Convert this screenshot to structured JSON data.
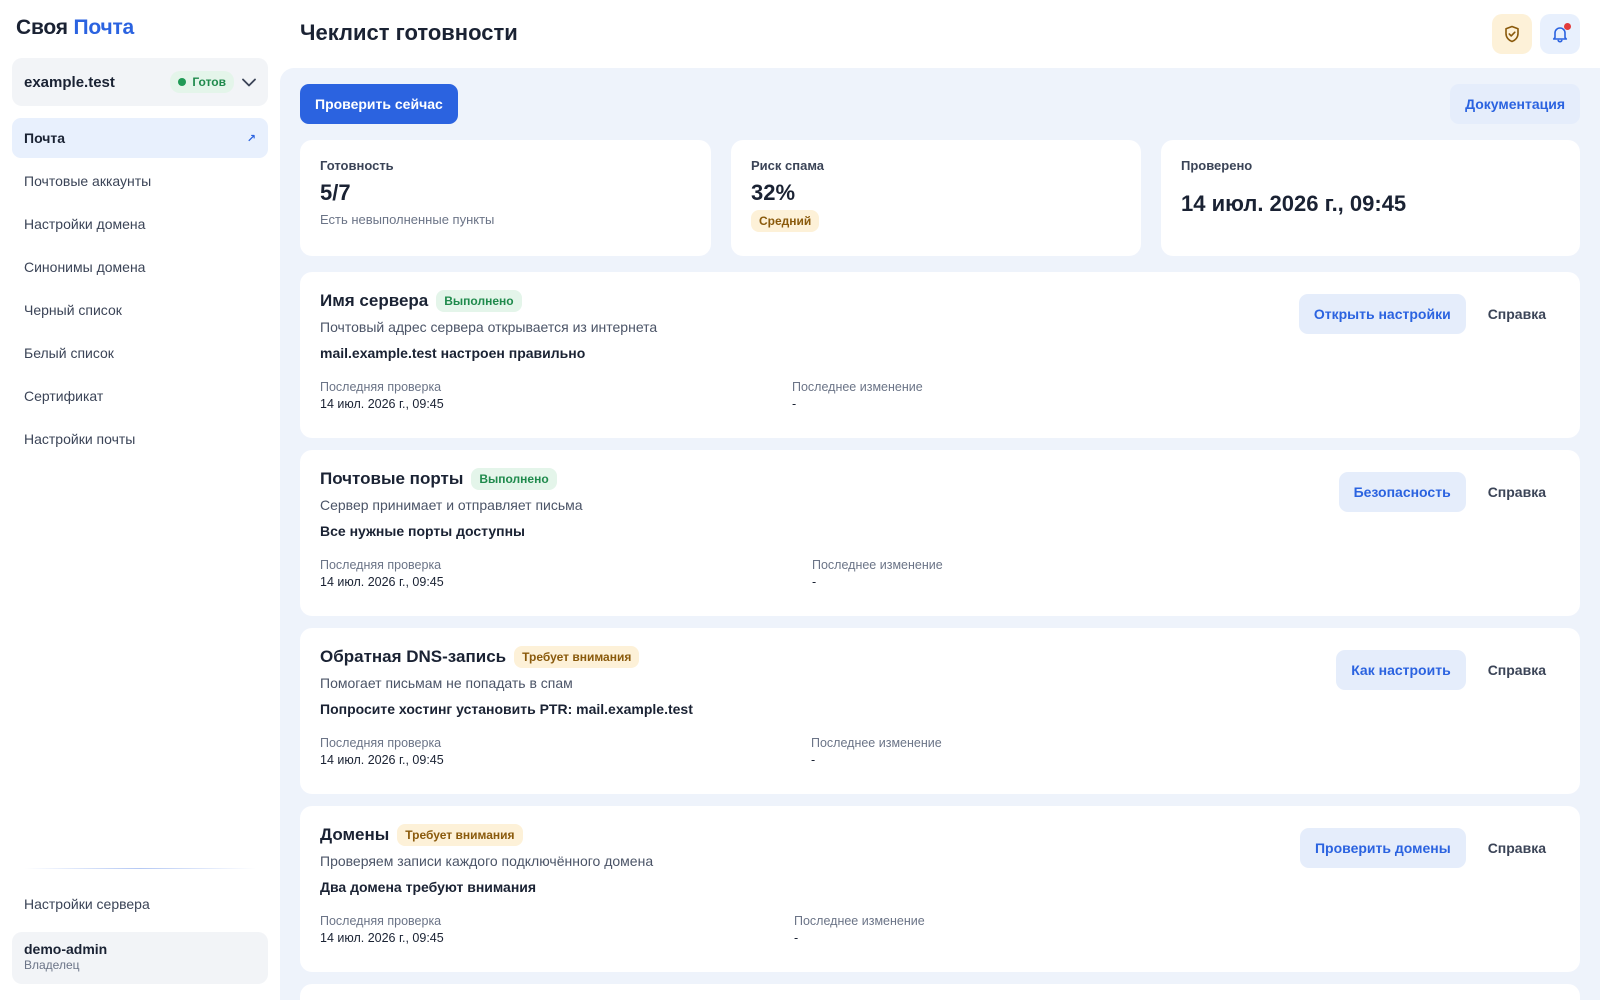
{
  "brand": {
    "part1": "Своя",
    "part2": "Почта"
  },
  "domain_selector": {
    "name": "example.test",
    "status": "Готов"
  },
  "nav": {
    "items": [
      {
        "label": "Почта",
        "active": true
      },
      {
        "label": "Почтовые аккаунты"
      },
      {
        "label": "Настройки домена"
      },
      {
        "label": "Синонимы домена"
      },
      {
        "label": "Черный список"
      },
      {
        "label": "Белый список"
      },
      {
        "label": "Сертификат"
      },
      {
        "label": "Настройки почты"
      }
    ],
    "server_settings": "Настройки сервера"
  },
  "user": {
    "name": "demo-admin",
    "role": "Владелец"
  },
  "header": {
    "title": "Чеклист готовности",
    "shield_icon": "shield-check-icon",
    "bell_icon": "bell-icon"
  },
  "toolbar": {
    "check_now": "Проверить сейчас",
    "docs": "Документация"
  },
  "stats": {
    "readiness": {
      "label": "Готовность",
      "value": "5/7",
      "sub": "Есть невыполненные пункты"
    },
    "spam_risk": {
      "label": "Риск спама",
      "value": "32%",
      "level": "Средний"
    },
    "checked": {
      "label": "Проверено",
      "value": "14 июл. 2026 г., 09:45"
    }
  },
  "checks": [
    {
      "title": "Имя сервера",
      "status": "Выполнено",
      "status_kind": "ok",
      "desc": "Почтовый адрес сервера открывается из интернета",
      "result": "mail.example.test настроен правильно",
      "last_check_label": "Последняя проверка",
      "last_check": "14 июл. 2026 г., 09:45",
      "last_change_label": "Последнее изменение",
      "last_change": "-",
      "action": "Открыть настройки",
      "help": "Справка"
    },
    {
      "title": "Почтовые порты",
      "status": "Выполнено",
      "status_kind": "ok",
      "desc": "Сервер принимает и отправляет письма",
      "result": "Все нужные порты доступны",
      "last_check_label": "Последняя проверка",
      "last_check": "14 июл. 2026 г., 09:45",
      "last_change_label": "Последнее изменение",
      "last_change": "-",
      "action": "Безопасность",
      "help": "Справка"
    },
    {
      "title": "Обратная DNS-запись",
      "status": "Требует внимания",
      "status_kind": "warn",
      "desc": "Помогает письмам не попадать в спам",
      "result": "Попросите хостинг установить PTR: mail.example.test",
      "last_check_label": "Последняя проверка",
      "last_check": "14 июл. 2026 г., 09:45",
      "last_change_label": "Последнее изменение",
      "last_change": "-",
      "action": "Как настроить",
      "help": "Справка"
    },
    {
      "title": "Домены",
      "status": "Требует внимания",
      "status_kind": "warn",
      "desc": "Проверяем записи каждого подключённого домена",
      "result": "Два домена требуют внимания",
      "last_check_label": "Последняя проверка",
      "last_check": "14 июл. 2026 г., 09:45",
      "last_change_label": "Последнее изменение",
      "last_change": "-",
      "action": "Проверить домены",
      "help": "Справка"
    }
  ]
}
